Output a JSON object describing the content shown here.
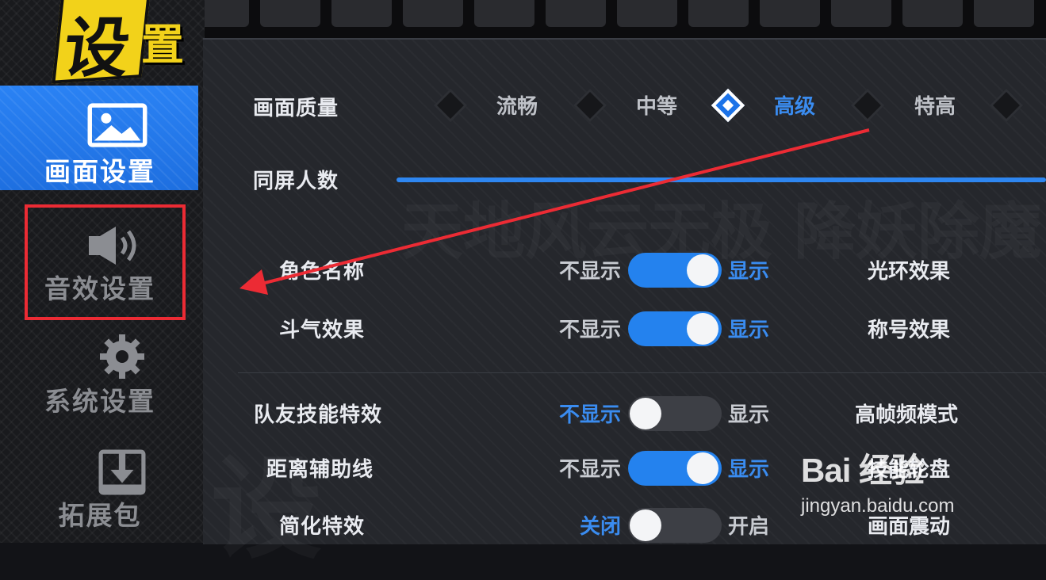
{
  "logo": {
    "char1": "设",
    "char2": "置"
  },
  "sidebar": {
    "items": [
      {
        "label": "画面设置",
        "icon": "image-icon",
        "active": true
      },
      {
        "label": "音效设置",
        "icon": "speaker-icon",
        "active": false
      },
      {
        "label": "系统设置",
        "icon": "gear-icon",
        "active": false
      },
      {
        "label": "拓展包",
        "icon": "download-icon",
        "active": false
      }
    ]
  },
  "quality": {
    "label": "画面质量",
    "options": [
      "流畅",
      "中等",
      "高级",
      "特高"
    ],
    "selected": "高级"
  },
  "players_on_screen": {
    "label": "同屏人数",
    "value_fraction": 1.0
  },
  "settings": [
    {
      "label": "角色名称",
      "off_text": "不显示",
      "on_text": "显示",
      "state": "on",
      "right_label": "光环效果"
    },
    {
      "label": "斗气效果",
      "off_text": "不显示",
      "on_text": "显示",
      "state": "on",
      "right_label": "称号效果"
    },
    {
      "label": "队友技能特效",
      "off_text": "不显示",
      "on_text": "显示",
      "state": "off",
      "right_label": "高帧频模式"
    },
    {
      "label": "距离辅助线",
      "off_text": "不显示",
      "on_text": "显示",
      "state": "on",
      "right_label": "技能轮盘"
    },
    {
      "label": "简化特效",
      "off_text": "关闭",
      "on_text": "开启",
      "state": "off",
      "right_label": "画面震动"
    }
  ],
  "watermark": {
    "brand": "Bai 经验",
    "site": "jingyan.baidu.com"
  },
  "colors": {
    "accent": "#2482ee",
    "highlight": "#ec2b34",
    "logo_yellow": "#f2d21a"
  }
}
